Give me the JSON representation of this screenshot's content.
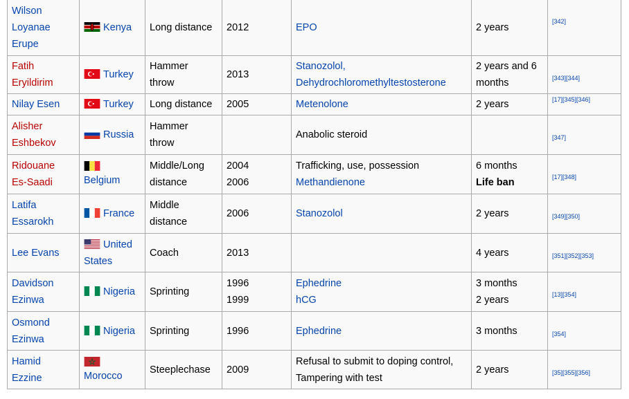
{
  "rows": [
    {
      "name": [
        "Wilson",
        "Loyanae",
        "Erupe"
      ],
      "name_color": "blue",
      "flag": "kenya",
      "country": [
        "Kenya"
      ],
      "event": [
        "Long distance"
      ],
      "year": [
        "2012"
      ],
      "substance": [
        "EPO"
      ],
      "substance_links": [
        true
      ],
      "ban": [
        "2 years"
      ],
      "ref": "[342]"
    },
    {
      "name": [
        "Fatih",
        "Eryildirim"
      ],
      "name_color": "red",
      "flag": "turkey",
      "country": [
        "Turkey"
      ],
      "event": [
        "Hammer",
        "throw"
      ],
      "year": [
        "2013"
      ],
      "substance": [
        "Stanozolol,",
        "Dehydrochloromethyltestosterone"
      ],
      "substance_links": [
        true,
        true
      ],
      "ban": [
        "2 years and 6",
        "months"
      ],
      "ref": "[343][344]"
    },
    {
      "name": [
        "Nilay Esen"
      ],
      "name_color": "blue",
      "flag": "turkey",
      "country": [
        "Turkey"
      ],
      "event": [
        "Long distance"
      ],
      "year": [
        "2005"
      ],
      "substance": [
        "Metenolone"
      ],
      "substance_links": [
        true
      ],
      "ban": [
        "2 years"
      ],
      "ref": "[17][345][346]"
    },
    {
      "name": [
        "Alisher",
        "Eshbekov"
      ],
      "name_color": "red",
      "flag": "russia",
      "country": [
        "Russia"
      ],
      "event": [
        "Hammer",
        "throw"
      ],
      "year": [],
      "substance": [
        "Anabolic steroid"
      ],
      "substance_links": [
        false
      ],
      "ban": [],
      "ref": "[347]"
    },
    {
      "name": [
        "Ridouane",
        "Es-Saadi"
      ],
      "name_color": "red",
      "flag": "belgium",
      "country": [
        "Belgium"
      ],
      "event": [
        "Middle/Long",
        "distance"
      ],
      "year": [
        "2004",
        "2006"
      ],
      "substance": [
        "Trafficking, use, possession",
        "Methandienone"
      ],
      "substance_links": [
        false,
        true
      ],
      "ban": [
        "6 months",
        "Life ban"
      ],
      "ban_bold": [
        false,
        true
      ],
      "ref": "[17][348]"
    },
    {
      "name": [
        "Latifa",
        "Essarokh"
      ],
      "name_color": "blue",
      "flag": "france",
      "country": [
        "France"
      ],
      "event": [
        "Middle",
        "distance"
      ],
      "year": [
        "2006"
      ],
      "substance": [
        "Stanozolol"
      ],
      "substance_links": [
        true
      ],
      "ban": [
        "2 years"
      ],
      "ref": "[349][350]"
    },
    {
      "name": [
        "Lee Evans"
      ],
      "name_color": "blue",
      "flag": "usa",
      "country": [
        "United",
        "States"
      ],
      "event": [
        "Coach"
      ],
      "year": [
        "2013"
      ],
      "substance": [],
      "substance_links": [],
      "ban": [
        "4 years"
      ],
      "ref": "[351][352][353]"
    },
    {
      "name": [
        "Davidson",
        "Ezinwa"
      ],
      "name_color": "blue",
      "flag": "nigeria",
      "country": [
        "Nigeria"
      ],
      "event": [
        "Sprinting"
      ],
      "year": [
        "1996",
        "1999"
      ],
      "substance": [
        "Ephedrine",
        "hCG"
      ],
      "substance_links": [
        true,
        true
      ],
      "ban": [
        "3 months",
        "2 years"
      ],
      "ref": "[13][354]"
    },
    {
      "name": [
        "Osmond",
        "Ezinwa"
      ],
      "name_color": "blue",
      "flag": "nigeria",
      "country": [
        "Nigeria"
      ],
      "event": [
        "Sprinting"
      ],
      "year": [
        "1996"
      ],
      "substance": [
        "Ephedrine"
      ],
      "substance_links": [
        true
      ],
      "ban": [
        "3 months"
      ],
      "ref": "[354]"
    },
    {
      "name": [
        "Hamid",
        "Ezzine"
      ],
      "name_color": "blue",
      "flag": "morocco",
      "country": [
        "Morocco"
      ],
      "event": [
        "Steeplechase"
      ],
      "year": [
        "2009"
      ],
      "substance": [
        "Refusal to submit to doping control,",
        "Tampering with test"
      ],
      "substance_links": [
        false,
        false
      ],
      "ban": [
        "2 years"
      ],
      "ref": "[35][355][356]"
    }
  ],
  "colors": {
    "link": "#0645ad",
    "redlink": "#ba0000",
    "border": "#aaaaaa",
    "cell_bg": "#f9f9f9"
  }
}
